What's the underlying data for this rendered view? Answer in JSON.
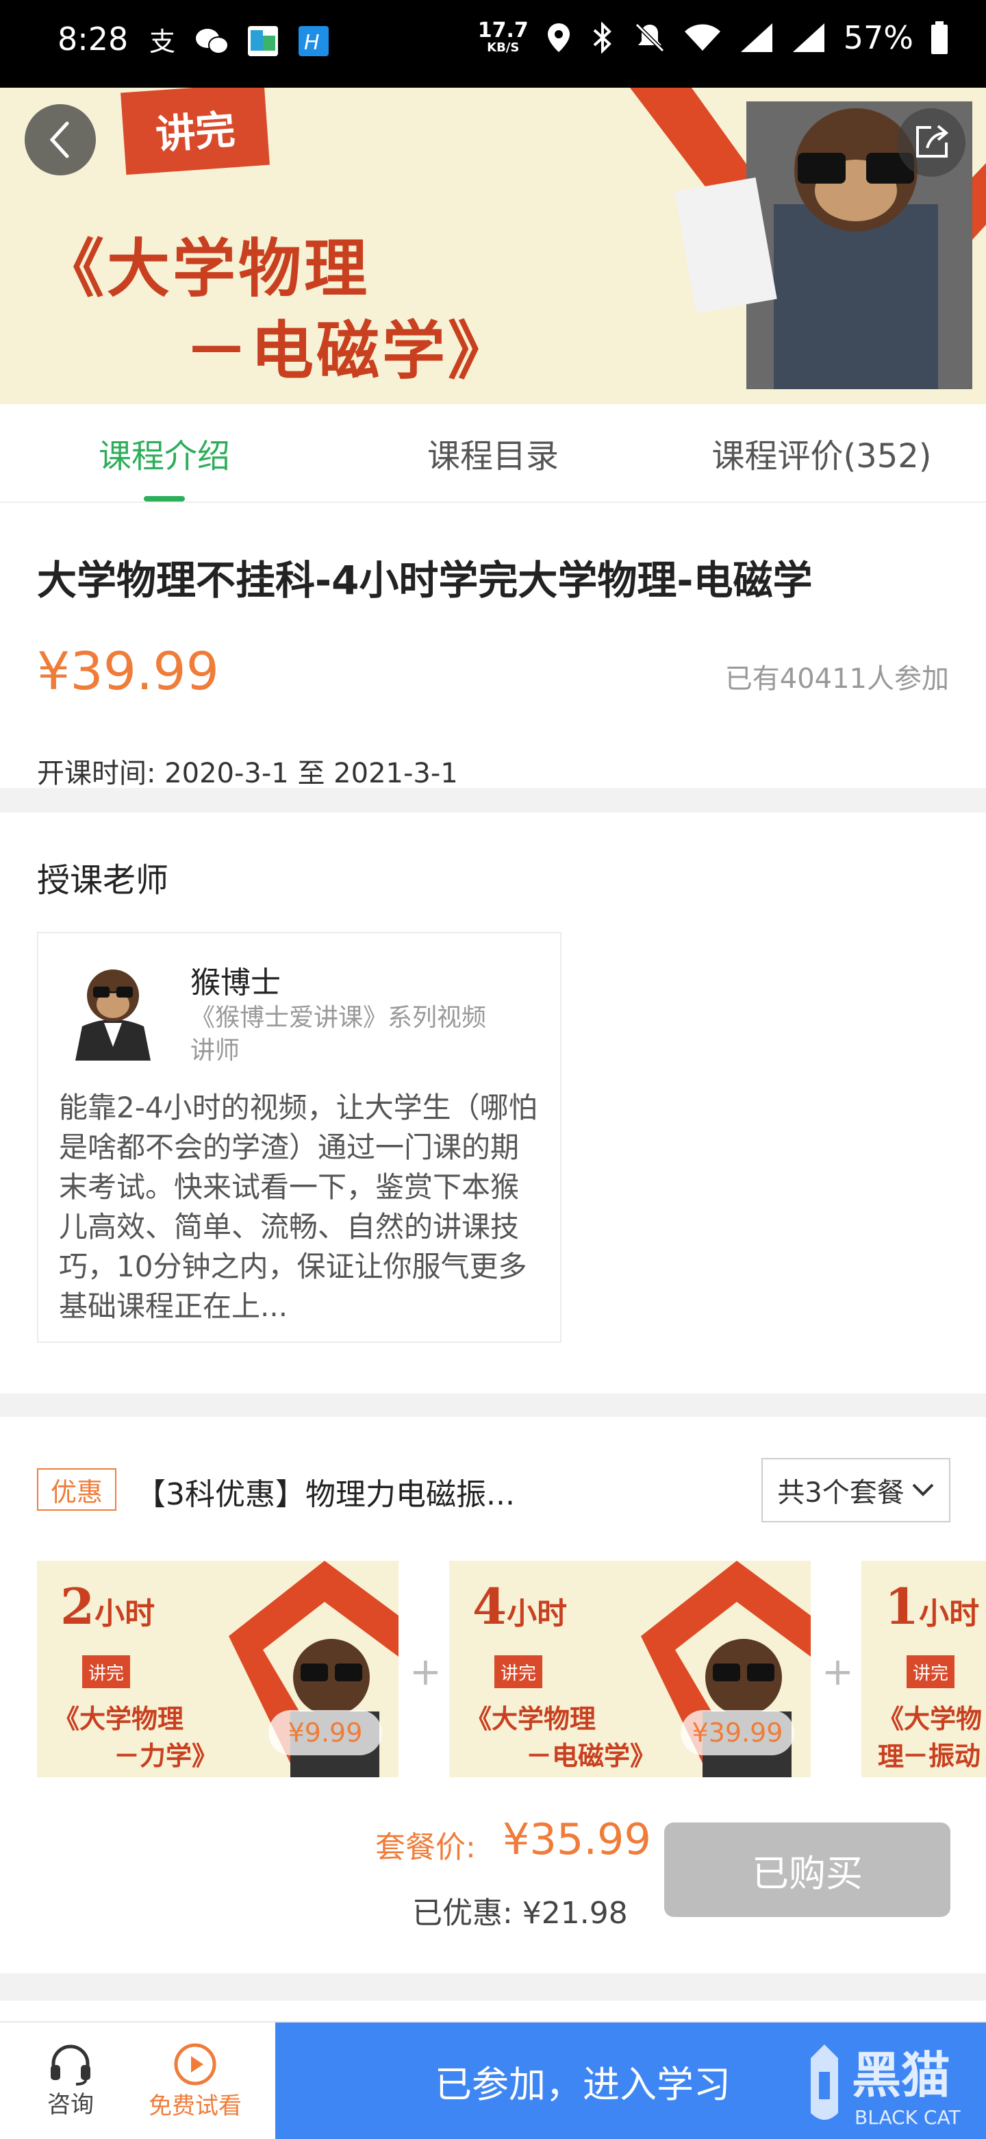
{
  "status_bar": {
    "time": "8:28",
    "net_speed_value": "17.7",
    "net_speed_unit": "KB/S",
    "battery": "57%",
    "icons": [
      "alipay-icon",
      "wechat-icon",
      "app-icon",
      "app2-icon",
      "location-icon",
      "bluetooth-icon",
      "mute-icon",
      "wifi-icon",
      "signal-icon",
      "battery-icon"
    ]
  },
  "banner": {
    "tag": "讲完",
    "line1": "《大学物理",
    "line2": "－电磁学》"
  },
  "tabs": [
    {
      "label": "课程介绍",
      "active": true
    },
    {
      "label": "课程目录",
      "active": false
    },
    {
      "label": "课程评价(352)",
      "active": false
    }
  ],
  "course": {
    "title": "大学物理不挂科-4小时学完大学物理-电磁学",
    "price": "¥39.99",
    "enrolled": "已有40411人参加",
    "date": "开课时间: 2020-3-1 至 2021-3-1"
  },
  "teacher": {
    "section_title": "授课老师",
    "name": "猴博士",
    "subtitle": "《猴博士爱讲课》系列视频讲师",
    "description": "能靠2-4小时的视频，让大学生（哪怕是啥都不会的学渣）通过一门课的期末考试。快来试看一下，鉴赏下本猴儿高效、简单、流畅、自然的讲课技巧，10分钟之内，保证让你服气更多基础课程正在上..."
  },
  "promo": {
    "tag": "优惠",
    "title": "【3科优惠】物理力电磁振...",
    "select_label": "共3个套餐",
    "packages": [
      {
        "hours": "2",
        "hours_unit": "小时",
        "tag": "讲完",
        "line1": "《大学物理",
        "line2": "－力学》",
        "price": "¥9.99"
      },
      {
        "hours": "4",
        "hours_unit": "小时",
        "tag": "讲完",
        "line1": "《大学物理",
        "line2": "－电磁学》",
        "price": "¥39.99"
      },
      {
        "hours": "1",
        "hours_unit": "小时",
        "tag": "讲完",
        "line1": "《大学物理",
        "line2": "－振动"
      }
    ],
    "plus": "+",
    "package_price_label": "套餐价:",
    "package_price": "¥35.99",
    "saved": "已优惠: ¥21.98",
    "bought_label": "已购买"
  },
  "bottom_bar": {
    "consult_label": "咨询",
    "trial_label": "免费试看",
    "join_label": "已参加，进入学习",
    "watermark_text": "黑猫",
    "watermark_sub": "BLACK CAT"
  },
  "colors": {
    "green": "#2dae5a",
    "orange": "#f07c3a",
    "blue": "#3f86f5",
    "banner_red": "#c8401f"
  }
}
